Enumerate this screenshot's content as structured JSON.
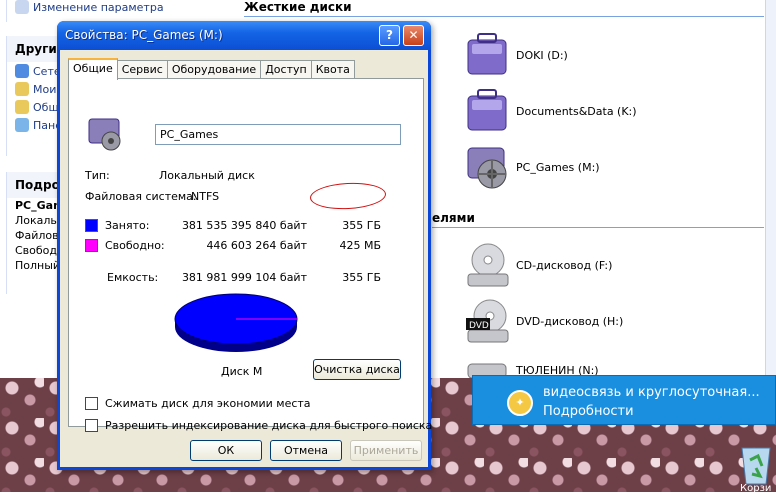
{
  "explorer": {
    "left_top_item": "Изменение параметра",
    "other_places": {
      "title": "Другие",
      "items": [
        "Сетe",
        "Мои",
        "Общ",
        "Пане"
      ]
    },
    "details": {
      "title": "Подроб",
      "items": [
        "PC_Gam",
        "Локальный",
        "Файловая",
        "Свободно",
        "Полный о"
      ]
    },
    "groups": {
      "hard_disks": "Жесткие диски",
      "removable_partial": "елями"
    },
    "drives": [
      {
        "label": "DOKI (D:)",
        "icon": "hard-drive-icon"
      },
      {
        "label": "Documents&Data (K:)",
        "icon": "hard-drive-icon"
      },
      {
        "label": "PC_Games (M:)",
        "icon": "shared-drive-icon"
      },
      {
        "label": "CD-дисковод (F:)",
        "icon": "cd-drive-icon"
      },
      {
        "label": "DVD-дисковод (H:)",
        "icon": "dvd-drive-icon"
      },
      {
        "label": "ТЮЛЕНИН (N:)",
        "icon": "drive-icon"
      }
    ]
  },
  "balloon": {
    "line1": "видеосвязь и круглосуточная...",
    "line2": "Подробности"
  },
  "desktop": {
    "recycle_label": "Корзи"
  },
  "dialog": {
    "title": "Свойства: PC_Games (M:)",
    "tabs": [
      "Общие",
      "Сервис",
      "Оборудование",
      "Доступ",
      "Квота"
    ],
    "name_value": "PC_Games",
    "type_label": "Тип:",
    "type_value": "Локальный диск",
    "fs_label": "Файловая система:",
    "fs_value": "NTFS",
    "used_label": "Занято:",
    "used_bytes": "381 535 395 840 байт",
    "used_size": "355 ГБ",
    "free_label": "Свободно:",
    "free_bytes": "446 603 264 байт",
    "free_size": "425 МБ",
    "capacity_label": "Емкость:",
    "capacity_bytes": "381 981 999 104 байт",
    "capacity_size": "355 ГБ",
    "disk_label": "Диск M",
    "cleanup_button": "Очистка диска",
    "compress_label": "Сжимать диск для экономии места",
    "index_label": "Разрешить индексирование диска для быстрого поиска",
    "ok": "ОК",
    "cancel": "Отмена",
    "apply": "Применить",
    "colors": {
      "used": "#0000ff",
      "free": "#ff00ff"
    }
  }
}
